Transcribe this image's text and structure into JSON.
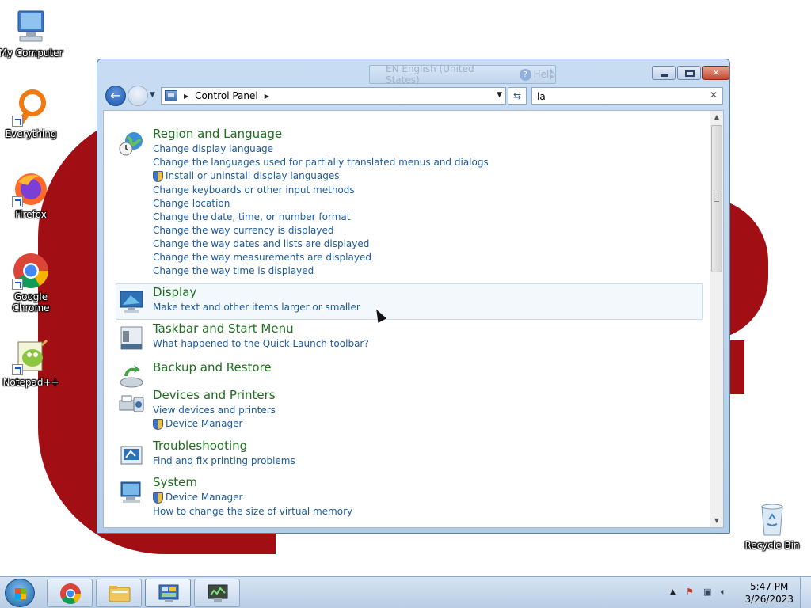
{
  "desktop": {
    "icons": [
      {
        "label": "My Computer"
      },
      {
        "label": "Everything"
      },
      {
        "label": "Firefox"
      },
      {
        "label": "Google Chrome"
      },
      {
        "label": "Notepad++"
      },
      {
        "label": "Recycle Bin"
      }
    ]
  },
  "window": {
    "language_bar": {
      "language": "EN English (United States)",
      "help": "Help"
    },
    "address": {
      "crumb": "Control Panel"
    },
    "search": {
      "value": "la"
    },
    "groups": [
      {
        "title": "Region and Language",
        "tasks": [
          {
            "label": "Change display language",
            "shield": false
          },
          {
            "label": "Change the languages used for partially translated menus and dialogs",
            "shield": false
          },
          {
            "label": "Install or uninstall display languages",
            "shield": true
          },
          {
            "label": "Change keyboards or other input methods",
            "shield": false
          },
          {
            "label": "Change location",
            "shield": false
          },
          {
            "label": "Change the date, time, or number format",
            "shield": false
          },
          {
            "label": "Change the way currency is displayed",
            "shield": false
          },
          {
            "label": "Change the way dates and lists are displayed",
            "shield": false
          },
          {
            "label": "Change the way measurements are displayed",
            "shield": false
          },
          {
            "label": "Change the way time is displayed",
            "shield": false
          }
        ]
      },
      {
        "title": "Display",
        "tasks": [
          {
            "label": "Make text and other items larger or smaller",
            "shield": false
          }
        ]
      },
      {
        "title": "Taskbar and Start Menu",
        "tasks": [
          {
            "label": "What happened to the Quick Launch toolbar?",
            "shield": false
          }
        ]
      },
      {
        "title": "Backup and Restore",
        "tasks": []
      },
      {
        "title": "Devices and Printers",
        "tasks": [
          {
            "label": "View devices and printers",
            "shield": false
          },
          {
            "label": "Device Manager",
            "shield": true
          }
        ]
      },
      {
        "title": "Troubleshooting",
        "tasks": [
          {
            "label": "Find and fix printing problems",
            "shield": false
          }
        ]
      },
      {
        "title": "System",
        "tasks": [
          {
            "label": "Device Manager",
            "shield": true
          },
          {
            "label": "How to change the size of virtual memory",
            "shield": false
          }
        ]
      }
    ]
  },
  "taskbar": {
    "clock": {
      "time": "5:47 PM",
      "date": "3/26/2023"
    }
  },
  "colors": {
    "group_title": "#1e6e1e",
    "task_link": "#1b5a9f",
    "wallpaper_red": "#a10f14"
  }
}
